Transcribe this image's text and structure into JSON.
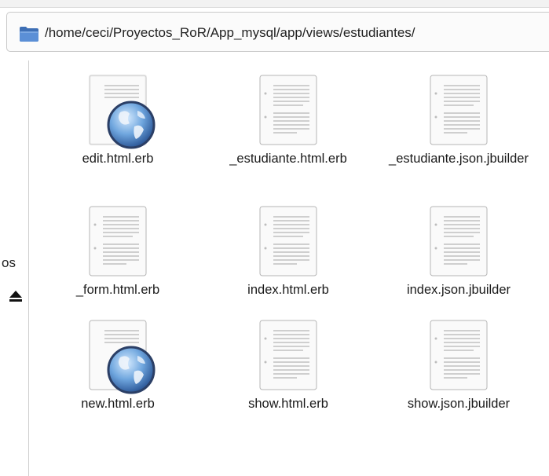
{
  "location": {
    "path": "/home/ceci/Proyectos_RoR/App_mysql/app/views/estudiantes/",
    "icon": "folder-icon"
  },
  "sidebar": {
    "partial_label": "os",
    "eject_icon": "eject-icon"
  },
  "files": [
    {
      "name": "edit.html.erb",
      "icon": "web-document-icon"
    },
    {
      "name": "_estudiante.html.erb",
      "icon": "text-document-icon"
    },
    {
      "name": "_estudiante.json.jbuilder",
      "icon": "text-document-icon"
    },
    {
      "name": "_form.html.erb",
      "icon": "text-document-icon"
    },
    {
      "name": "index.html.erb",
      "icon": "text-document-icon"
    },
    {
      "name": "index.json.jbuilder",
      "icon": "text-document-icon"
    },
    {
      "name": "new.html.erb",
      "icon": "web-document-icon"
    },
    {
      "name": "show.html.erb",
      "icon": "text-document-icon"
    },
    {
      "name": "show.json.jbuilder",
      "icon": "text-document-icon"
    }
  ]
}
